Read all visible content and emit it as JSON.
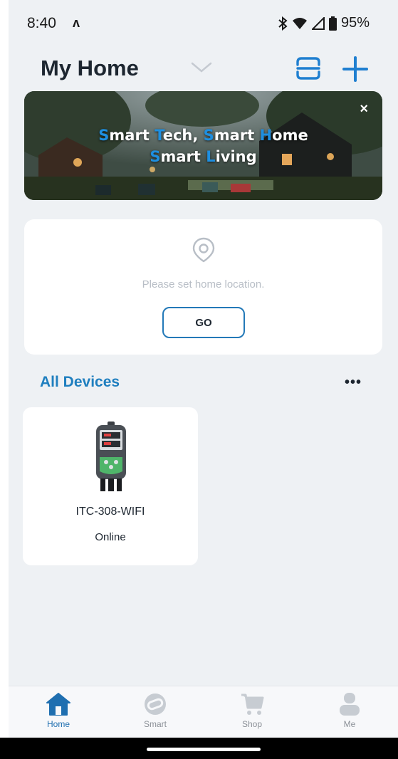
{
  "status_bar": {
    "time": "8:40",
    "notification_glyph": "ʌ",
    "battery": "95%"
  },
  "header": {
    "title": "My Home",
    "icons": [
      "chevron-down-icon",
      "scan-icon",
      "plus-icon"
    ]
  },
  "banner": {
    "line1": [
      {
        "t": "S",
        "hl": true
      },
      {
        "t": "mart ",
        "hl": false
      },
      {
        "t": "T",
        "hl": true
      },
      {
        "t": "ech, ",
        "hl": false
      },
      {
        "t": "S",
        "hl": true
      },
      {
        "t": "mart ",
        "hl": false
      },
      {
        "t": "H",
        "hl": true
      },
      {
        "t": "ome",
        "hl": false
      }
    ],
    "line2": [
      {
        "t": "S",
        "hl": true
      },
      {
        "t": "mart ",
        "hl": false
      },
      {
        "t": "L",
        "hl": true
      },
      {
        "t": "iving",
        "hl": false
      }
    ],
    "close": "×"
  },
  "location_card": {
    "message": "Please set home location.",
    "button": "GO"
  },
  "devices": {
    "title": "All Devices",
    "more": "•••",
    "items": [
      {
        "name": "ITC-308-WIFI",
        "status": "Online"
      }
    ]
  },
  "nav": {
    "items": [
      {
        "label": "Home",
        "icon": "home-icon",
        "active": true
      },
      {
        "label": "Smart",
        "icon": "smart-icon",
        "active": false
      },
      {
        "label": "Shop",
        "icon": "cart-icon",
        "active": false
      },
      {
        "label": "Me",
        "icon": "person-icon",
        "active": false
      }
    ]
  },
  "colors": {
    "accent": "#1f7fbf",
    "background": "#eef1f4",
    "card": "#ffffff",
    "muted_text": "#b8bec6"
  }
}
